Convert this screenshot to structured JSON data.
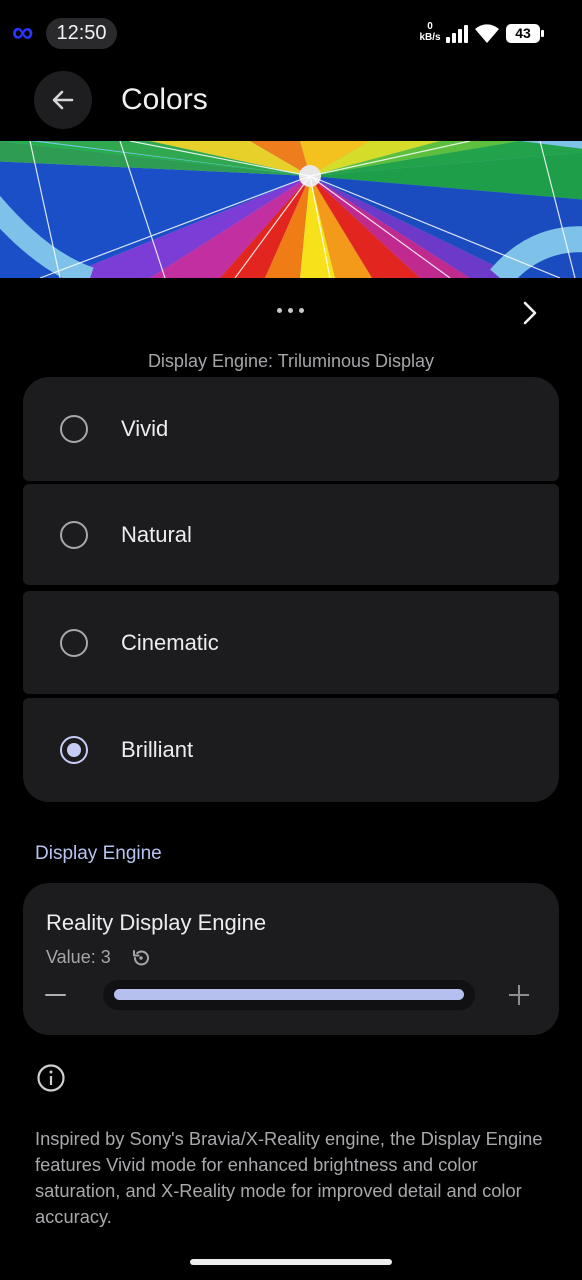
{
  "status_bar": {
    "time": "12:50",
    "net_speed_value": "0",
    "net_speed_unit": "kB/s",
    "battery_level": "43"
  },
  "app_bar": {
    "title": "Colors"
  },
  "preview": {
    "caption": "Display Engine: Triluminous Display"
  },
  "color_modes": [
    {
      "label": "Vivid",
      "selected": false
    },
    {
      "label": "Natural",
      "selected": false
    },
    {
      "label": "Cinematic",
      "selected": false
    },
    {
      "label": "Brilliant",
      "selected": true
    }
  ],
  "display_engine": {
    "section_title": "Display Engine",
    "setting_title": "Reality Display Engine",
    "value_text": "Value: 3",
    "slider_fraction": 1.0
  },
  "description": "Inspired by Sony's Bravia/X-Reality engine, the Display Engine features Vivid mode for enhanced brightness and color saturation, and X-Reality mode for improved detail and color accuracy.",
  "colors": {
    "background": "#000000",
    "card": "#1c1c1e",
    "accent": "#c5ccf6",
    "infinity_logo": "#2b35ff"
  }
}
